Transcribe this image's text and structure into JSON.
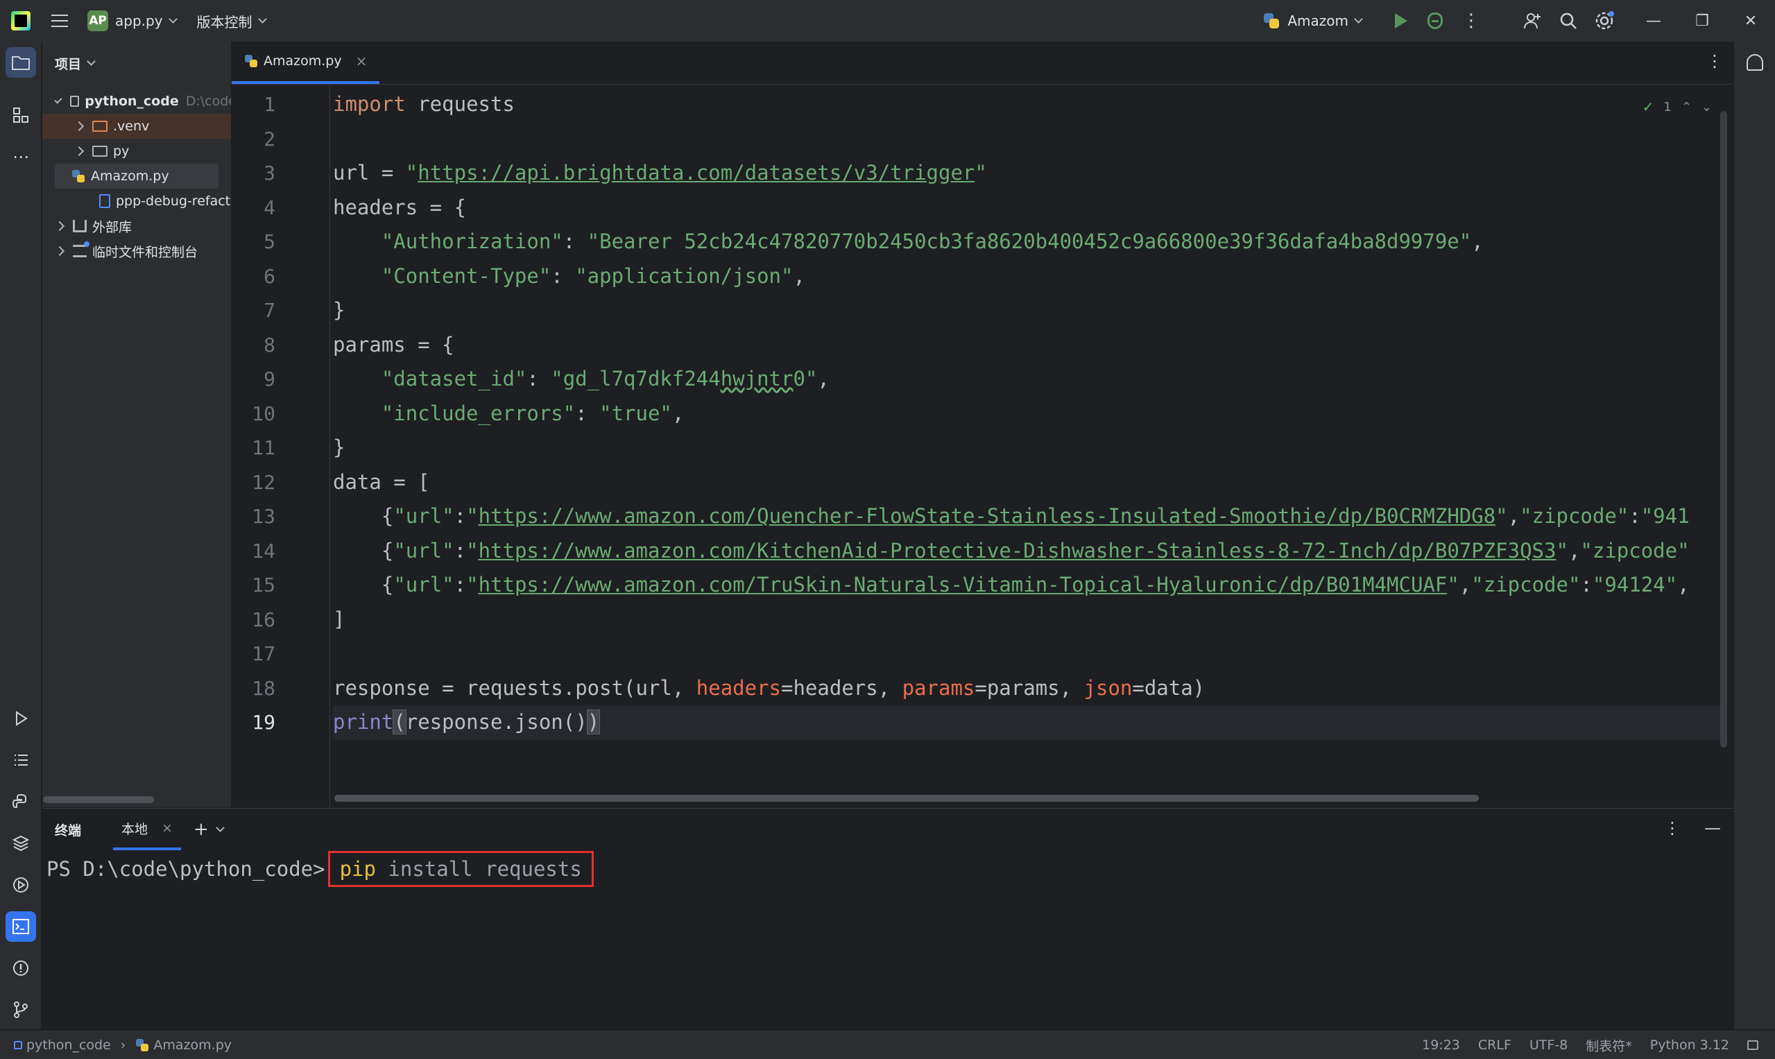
{
  "titlebar": {
    "project_badge": "AP",
    "project_name": "app.py",
    "vcs_menu": "版本控制",
    "run_config": "Amazom"
  },
  "project_panel": {
    "title": "项目",
    "tree": [
      {
        "label": "python_code",
        "hint": "D:\\code"
      },
      {
        "label": ".venv"
      },
      {
        "label": "py"
      },
      {
        "label": "Amazom.py"
      },
      {
        "label": "ppp-debug-refacto"
      },
      {
        "label": "外部库"
      },
      {
        "label": "临时文件和控制台"
      }
    ]
  },
  "editor": {
    "tab_label": "Amazom.py",
    "tab_close": "×",
    "inspection_count": "1",
    "line_numbers": [
      "1",
      "2",
      "3",
      "4",
      "5",
      "6",
      "7",
      "8",
      "9",
      "10",
      "11",
      "12",
      "13",
      "14",
      "15",
      "16",
      "17",
      "18",
      "19"
    ],
    "code": {
      "l1_kw": "import",
      "l1_rest": " requests",
      "l3_a": "url = ",
      "l3_q1": "\"",
      "l3_url": "https://api.brightdata.com/datasets/v3/trigger",
      "l3_q2": "\"",
      "l4": "headers = {",
      "l5_key": "\"Authorization\"",
      "l5_colon": ": ",
      "l5_val": "\"Bearer 52cb24c47820770b2450cb3fa8620b400452c9a66800e39f36dafa4ba8d9979e\"",
      "l5_end": ",",
      "l6_key": "\"Content-Type\"",
      "l6_colon": ": ",
      "l6_val": "\"application/json\"",
      "l6_end": ",",
      "l7": "}",
      "l8": "params = {",
      "l9_key": "\"dataset_id\"",
      "l9_colon": ": ",
      "l9_val_a": "\"gd_l7q7dkf244",
      "l9_val_b": "hwjntr",
      "l9_val_c": "0\"",
      "l9_end": ",",
      "l10_key": "\"include_errors\"",
      "l10_colon": ": ",
      "l10_val": "\"true\"",
      "l10_end": ",",
      "l11": "}",
      "l12": "data = [",
      "l13_a": "{",
      "l13_key": "\"url\"",
      "l13_colon": ":",
      "l13_q1": "\"",
      "l13_url": "https://www.amazon.com/Quencher-FlowState-Stainless-Insulated-Smoothie/dp/B0CRMZHDG8",
      "l13_q2": "\"",
      "l13_comma": ",",
      "l13_zkey": "\"zipcode\"",
      "l13_zcolon": ":",
      "l13_zval": "\"941",
      "l14_a": "{",
      "l14_key": "\"url\"",
      "l14_colon": ":",
      "l14_q1": "\"",
      "l14_url": "https://www.amazon.com/KitchenAid-Protective-Dishwasher-Stainless-8-72-Inch/dp/B07PZF3QS3",
      "l14_q2": "\"",
      "l14_comma": ",",
      "l14_zkey": "\"zipcode\"",
      "l15_a": "{",
      "l15_key": "\"url\"",
      "l15_colon": ":",
      "l15_q1": "\"",
      "l15_url": "https://www.amazon.com/TruSkin-Naturals-Vitamin-Topical-Hyaluronic/dp/B01M4MCUAF",
      "l15_q2": "\"",
      "l15_comma": ",",
      "l15_zkey": "\"zipcode\"",
      "l15_zcolon": ":",
      "l15_zval": "\"94124\"",
      "l15_end": ",",
      "l16": "]",
      "l18_a": "response = requests.post(url, ",
      "l18_k1": "headers",
      "l18_b": "=headers, ",
      "l18_k2": "params",
      "l18_c": "=params, ",
      "l18_k3": "json",
      "l18_d": "=data)",
      "l19_fn": "print",
      "l19_open": "(",
      "l19_mid": "response.json()",
      "l19_close": ")"
    }
  },
  "terminal": {
    "title": "终端",
    "tab_label": "本地",
    "tab_close": "×",
    "add": "+",
    "prompt": "PS D:\\code\\python_code>",
    "cmd_pip": "pip",
    "cmd_rest": " install requests"
  },
  "statusbar": {
    "project": "python_code",
    "file": "Amazom.py",
    "position": "19:23",
    "line_sep": "CRLF",
    "encoding": "UTF-8",
    "indent": "制表符*",
    "interpreter": "Python 3.12"
  }
}
